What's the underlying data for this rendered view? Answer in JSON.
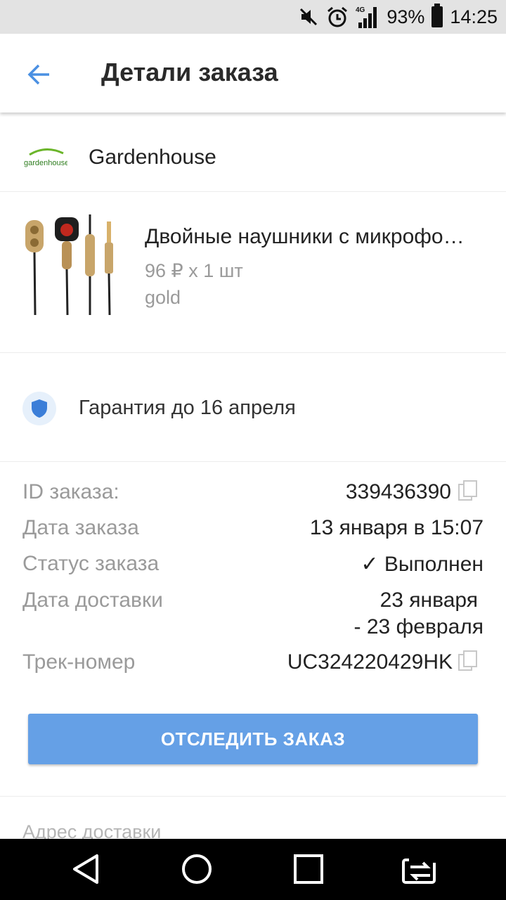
{
  "status_bar": {
    "network": "4G",
    "battery": "93%",
    "time": "14:25",
    "icons": [
      "mute-icon",
      "alarm-icon",
      "signal-icon",
      "battery-icon"
    ]
  },
  "appbar": {
    "title": "Детали заказа",
    "back_icon": "arrow-left-icon",
    "accent_color": "#4a90e2"
  },
  "seller": {
    "logo_text": "gardenhouse",
    "name": "Gardenhouse"
  },
  "product": {
    "title": "Двойные наушники с микрофоном",
    "price_qty": "96 ₽ x 1 шт",
    "variant": "gold"
  },
  "guarantee": {
    "text": "Гарантия до 16 апреля",
    "icon": "shield-icon"
  },
  "order": {
    "id_label": "ID заказа:",
    "id_value": "339436390",
    "date_label": "Дата заказа",
    "date_value": "13 января в 15:07",
    "status_label": "Статус заказа",
    "status_value": "✓ Выполнен",
    "delivery_label": "Дата доставки",
    "delivery_value_line1": "23 января",
    "delivery_value_line2": "- 23 февраля",
    "track_label": "Трек-номер",
    "track_value": "UC324220429HK"
  },
  "track_button": {
    "label": "ОТСЛЕДИТЬ ЗАКАЗ",
    "color": "#65a0e6"
  },
  "address": {
    "label": "Адрес доставки"
  },
  "navbar": {
    "icons": [
      "back-triangle-icon",
      "home-circle-icon",
      "recents-square-icon",
      "switch-app-icon"
    ]
  }
}
